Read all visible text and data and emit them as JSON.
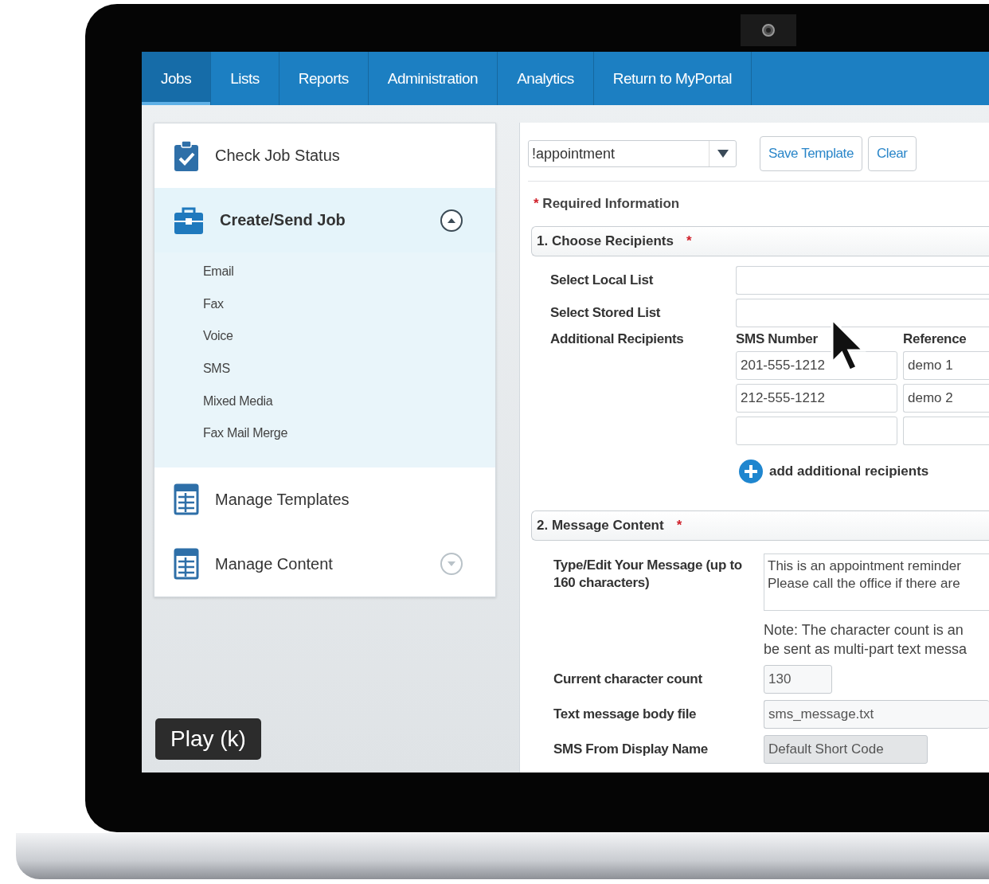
{
  "nav": {
    "tabs": [
      {
        "label": "Jobs",
        "selected": true
      },
      {
        "label": "Lists",
        "selected": false
      },
      {
        "label": "Reports",
        "selected": false
      },
      {
        "label": "Administration",
        "selected": false
      },
      {
        "label": "Analytics",
        "selected": false
      },
      {
        "label": "Return to MyPortal",
        "selected": false
      }
    ]
  },
  "sidebar": {
    "items": [
      {
        "label": "Check Job Status",
        "kind": "link",
        "selected": false
      },
      {
        "label": "Create/Send Job",
        "kind": "group",
        "selected": true,
        "expanded": true,
        "children": [
          {
            "label": "Email"
          },
          {
            "label": "Fax"
          },
          {
            "label": "Voice"
          },
          {
            "label": "SMS"
          },
          {
            "label": "Mixed Media"
          },
          {
            "label": "Fax Mail Merge"
          }
        ]
      },
      {
        "label": "Manage Templates",
        "kind": "link",
        "selected": false
      },
      {
        "label": "Manage Content",
        "kind": "group",
        "selected": false,
        "expanded": false
      }
    ]
  },
  "toolbar": {
    "template_select": {
      "value": "!appointment"
    },
    "buttons": [
      "Save Template",
      "Clear"
    ]
  },
  "required_note": {
    "mark": "*",
    "text": "Required Information"
  },
  "recipients": {
    "title": "1. Choose Recipients",
    "mark": "*",
    "local_list_label": "Select Local List",
    "stored_list_label": "Select Stored List",
    "additional_label": "Additional Recipients",
    "columns": [
      "SMS Number",
      "Reference"
    ],
    "rows": [
      {
        "sms_number": "201-555-1212",
        "reference": "demo 1"
      },
      {
        "sms_number": "212-555-1212",
        "reference": "demo 2"
      },
      {}
    ],
    "add_link": "add additional recipients"
  },
  "message": {
    "title": "2. Message Content",
    "mark": "*",
    "message_label": "Type/Edit Your Message (up to 160 characters)",
    "message_lines": [
      "This is an appointment reminder",
      "Please call the office if there are"
    ],
    "note_lines": [
      "Note: The character count is an",
      "be sent as multi-part text messa"
    ],
    "fields": [
      {
        "label": "Current character count",
        "value": "130",
        "kind": "short",
        "disabled": false
      },
      {
        "label": "Text message body file",
        "value": "sms_message.txt",
        "kind": "wide",
        "disabled": false
      },
      {
        "label": "SMS From Display Name",
        "value": "Default Short Code",
        "kind": "medium",
        "disabled": true
      }
    ]
  },
  "player_tooltip": "Play (k)"
}
